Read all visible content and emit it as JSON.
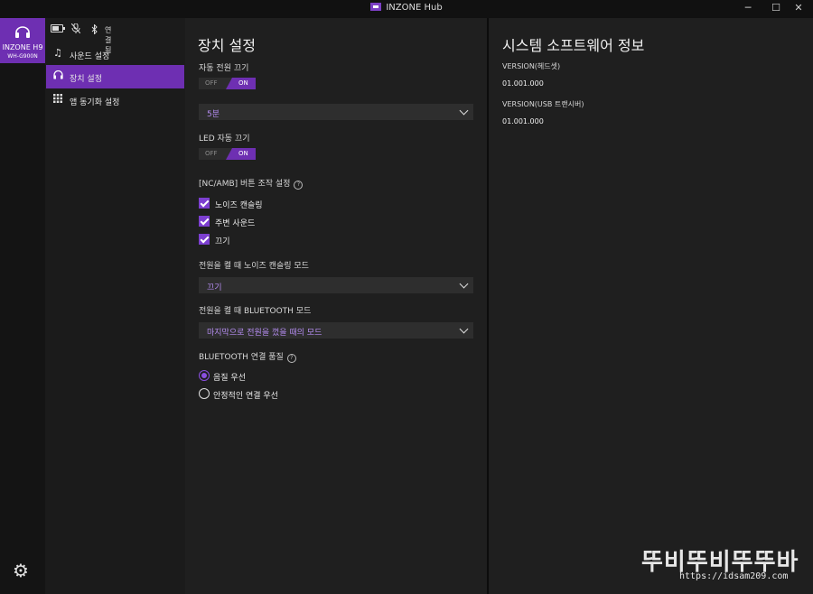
{
  "app": {
    "title": "INZONE Hub"
  },
  "window": {
    "minimize": "─",
    "maximize": "☐",
    "close": "✕"
  },
  "device": {
    "name": "INZONE H9",
    "model": "WH-G900N"
  },
  "status": {
    "connection": "연결됨"
  },
  "nav": {
    "items": [
      {
        "label": "사운드 설정",
        "icon": "music-note-icon"
      },
      {
        "label": "장치 설정",
        "icon": "headphones-icon"
      },
      {
        "label": "앱 동기화 설정",
        "icon": "grid-icon"
      }
    ]
  },
  "device_settings": {
    "title": "장치 설정",
    "auto_power_off": {
      "label": "자동 전원 끄기",
      "off": "OFF",
      "on": "ON",
      "timeout": "5분"
    },
    "led_auto_off": {
      "label": "LED 자동 끄기",
      "off": "OFF",
      "on": "ON"
    },
    "nc_amb_button": {
      "label": "[NC/AMB] 버튼 조작 설정",
      "help": "?",
      "options": [
        "노이즈 캔슬링",
        "주변 사운드",
        "끄기"
      ]
    },
    "nc_mode_on_power": {
      "label": "전원을 켤 때 노이즈 캔슬링 모드",
      "value": "끄기"
    },
    "bt_mode_on_power": {
      "label": "전원을 켤 때 BLUETOOTH 모드",
      "value": "마지막으로 전원을 껐을 때의 모드"
    },
    "bt_quality": {
      "label": "BLUETOOTH 연결 품질",
      "help": "?",
      "options": [
        "음질 우선",
        "안정적인 연결 우선"
      ],
      "selected": 0
    }
  },
  "system_software": {
    "title": "시스템 소프트웨어 정보",
    "headset_version_label": "VERSION(헤드셋)",
    "headset_version": "01.001.000",
    "usb_version_label": "VERSION(USB 트랜시버)",
    "usb_version": "01.001.000"
  },
  "watermark": {
    "text": "뚜비뚜비뚜뚜바",
    "url": "https://idsam209.com"
  },
  "colors": {
    "accent": "#6e2fb2",
    "background": "#1f1f1f",
    "titlebar": "#111111"
  }
}
